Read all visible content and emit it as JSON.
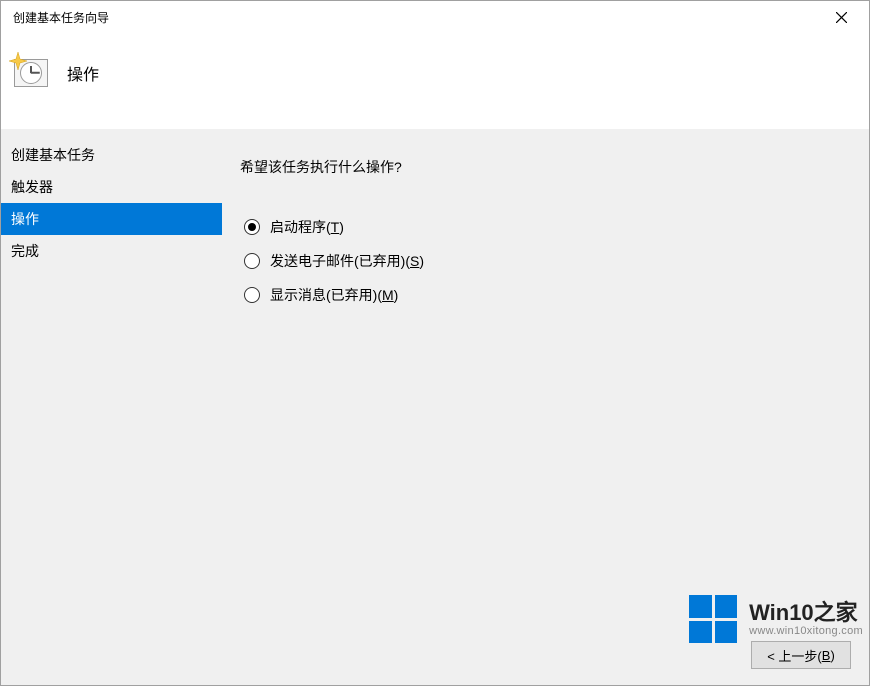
{
  "window": {
    "title": "创建基本任务向导"
  },
  "header": {
    "title": "操作"
  },
  "sidebar": {
    "items": [
      {
        "label": "创建基本任务",
        "selected": false
      },
      {
        "label": "触发器",
        "selected": false
      },
      {
        "label": "操作",
        "selected": true
      },
      {
        "label": "完成",
        "selected": false
      }
    ]
  },
  "main": {
    "prompt": "希望该任务执行什么操作?",
    "options": [
      {
        "label_prefix": "启动程序(",
        "mnemonic": "T",
        "label_suffix": ")",
        "checked": true
      },
      {
        "label_prefix": "发送电子邮件(已弃用)(",
        "mnemonic": "S",
        "label_suffix": ")",
        "checked": false
      },
      {
        "label_prefix": "显示消息(已弃用)(",
        "mnemonic": "M",
        "label_suffix": ")",
        "checked": false
      }
    ]
  },
  "buttons": {
    "back_prefix": "< 上一步(",
    "back_mnemonic": "B",
    "back_suffix": ")"
  },
  "watermark": {
    "brand": "Win10之家",
    "url": "www.win10xitong.com"
  }
}
